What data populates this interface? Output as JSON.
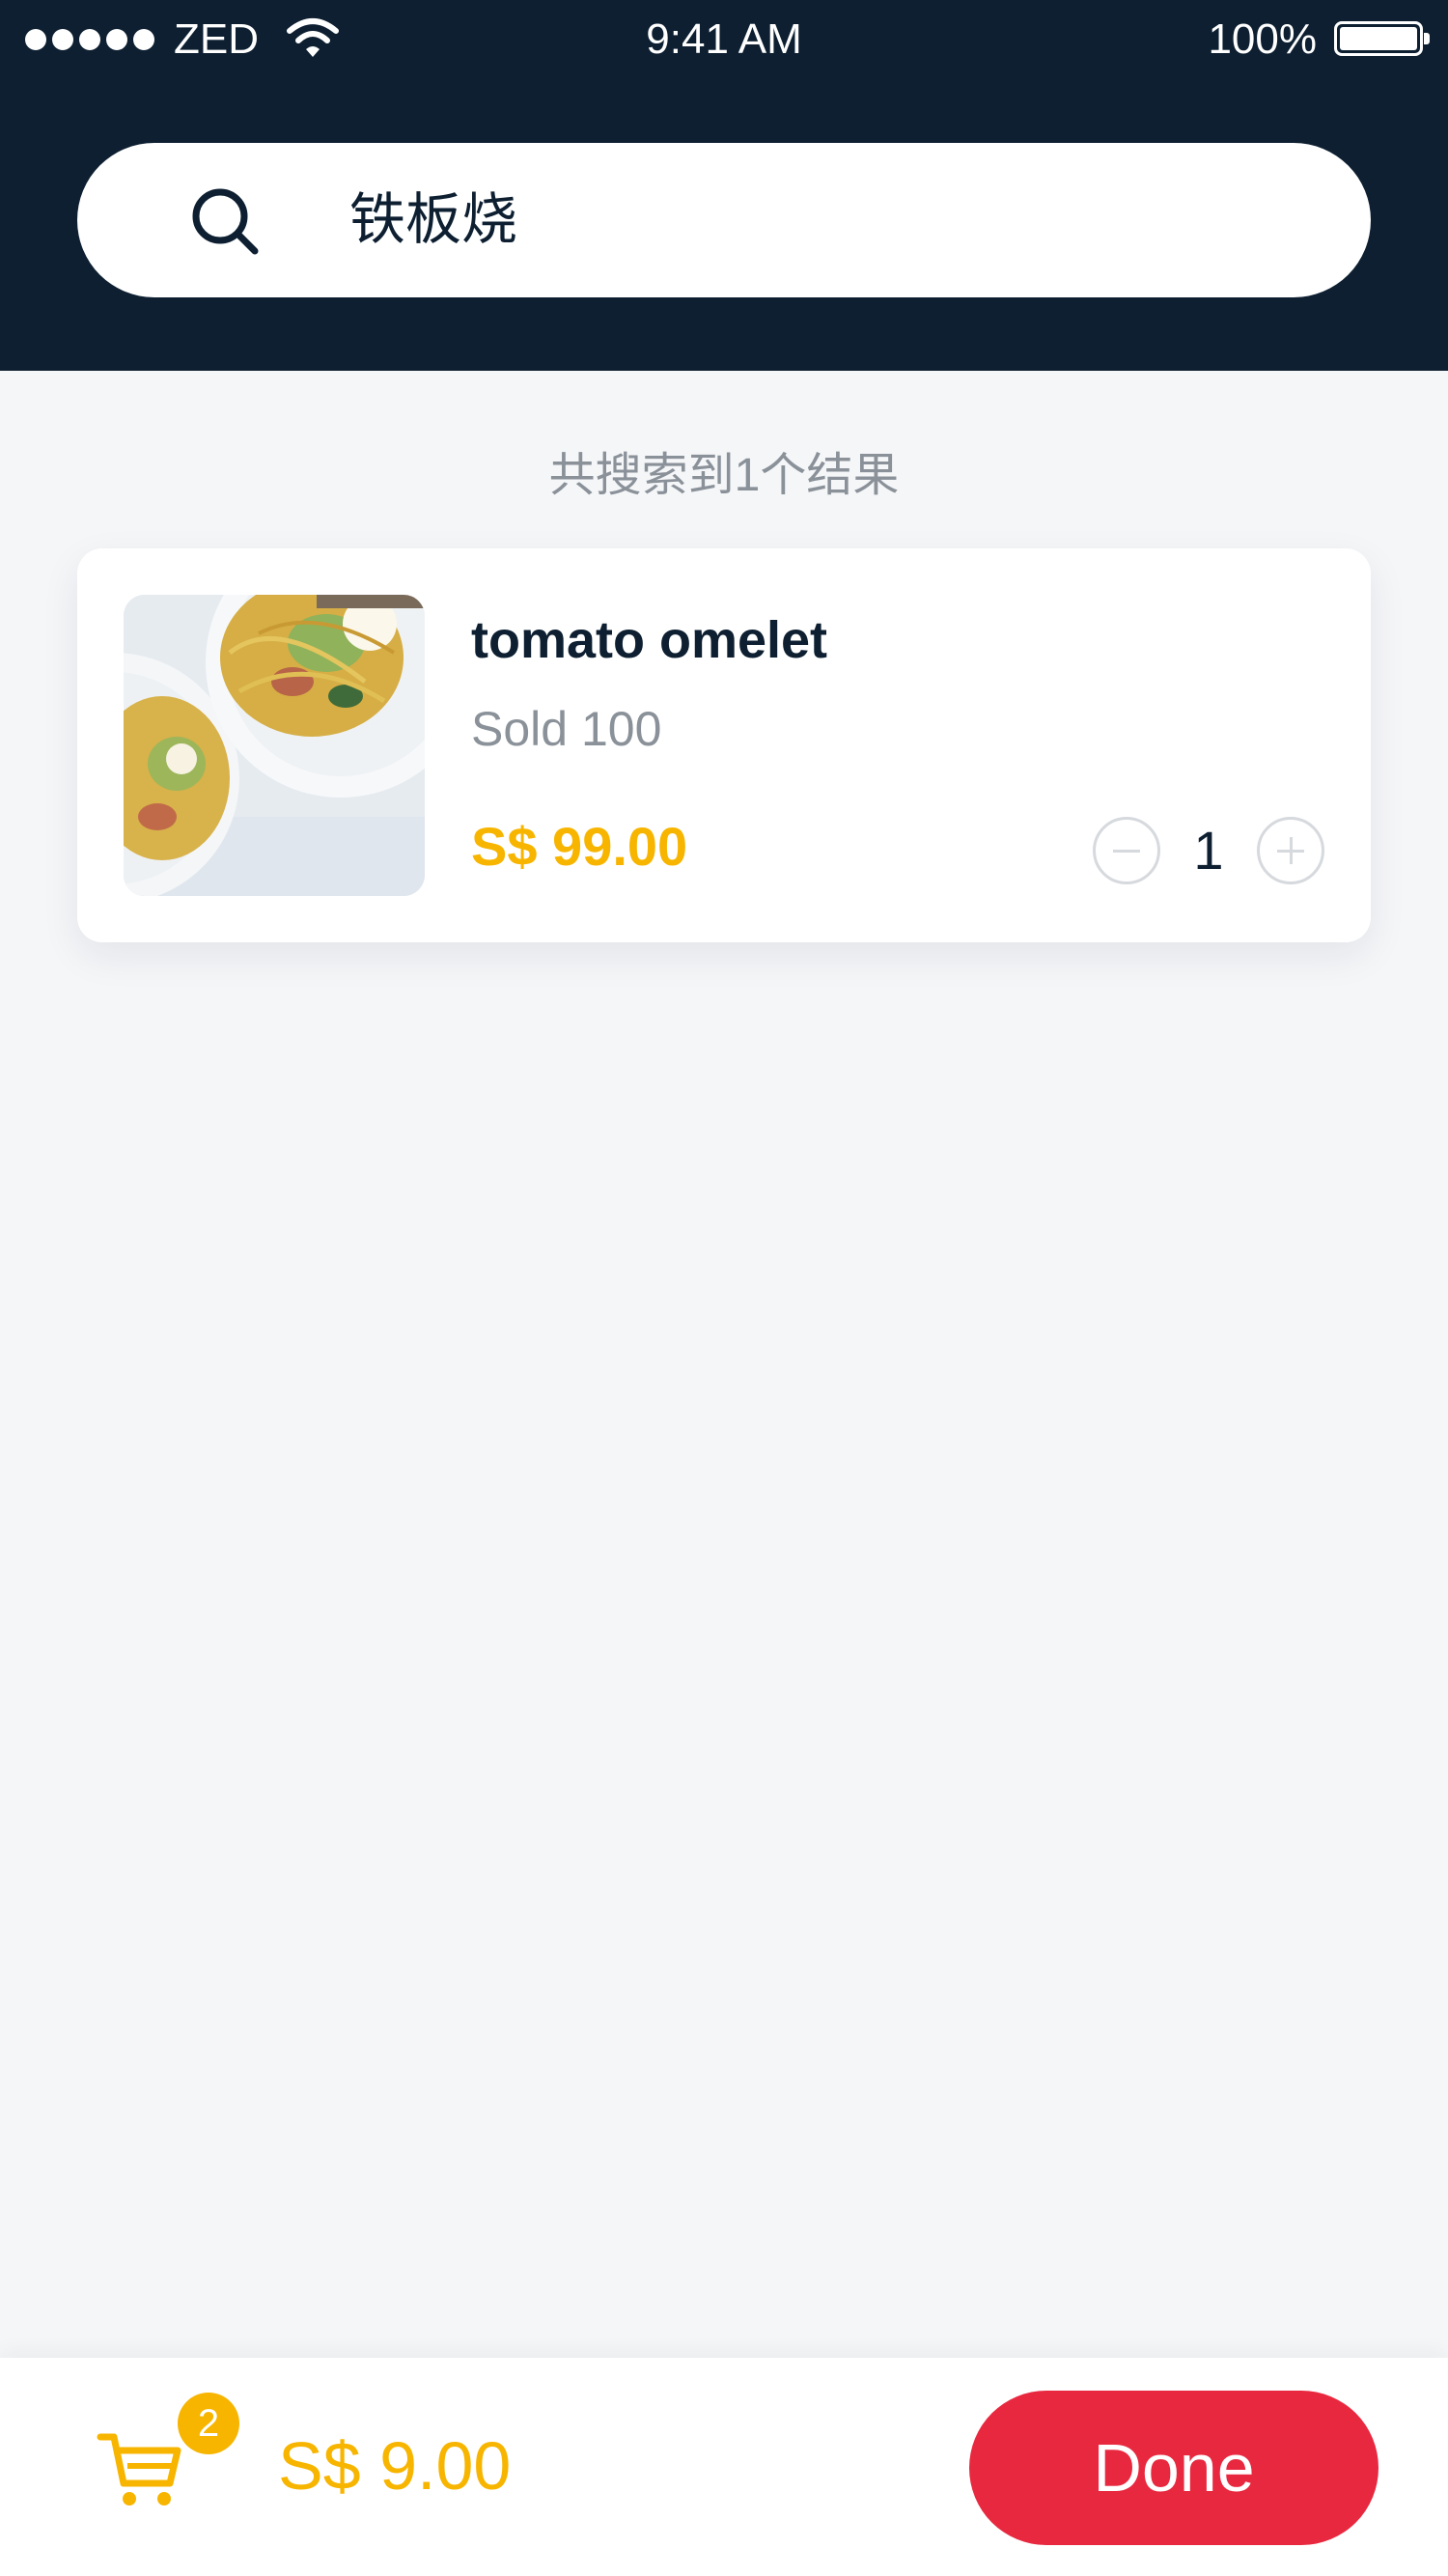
{
  "status_bar": {
    "carrier": "ZED",
    "time": "9:41 AM",
    "battery": "100%"
  },
  "search": {
    "query": "铁板烧",
    "icon": "search-icon"
  },
  "results": {
    "count_text": "共搜索到1个结果",
    "items": [
      {
        "name": "tomato omelet",
        "sold": "Sold 100",
        "price": "S$ 99.00",
        "quantity": "1",
        "image": "pasta-dish-photo"
      }
    ]
  },
  "cart": {
    "badge_count": "2",
    "total": "S$ 9.00",
    "icon": "cart-icon"
  },
  "actions": {
    "done_label": "Done"
  },
  "colors": {
    "header_bg": "#0d1f31",
    "accent": "#f7b500",
    "done_button": "#e8283f",
    "muted_text": "#8a9199"
  }
}
